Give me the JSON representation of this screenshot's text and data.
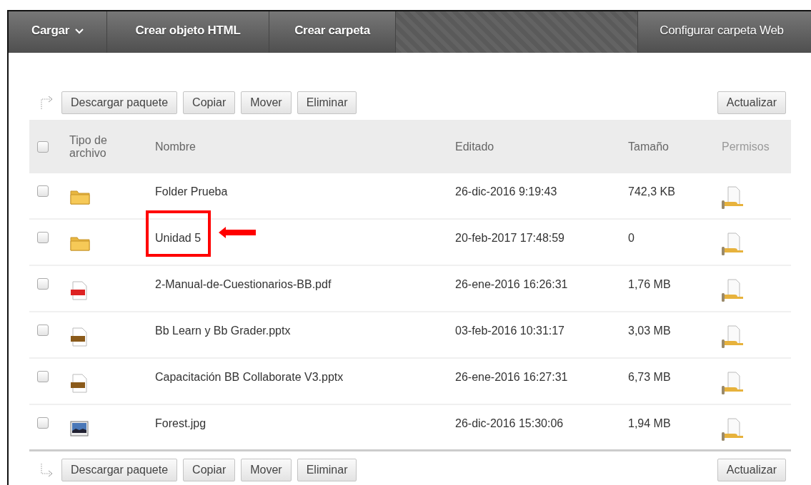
{
  "toolbar": {
    "items": [
      {
        "label": "Cargar",
        "kind": "dropdown"
      },
      {
        "label": "Crear objeto HTML",
        "kind": "button"
      },
      {
        "label": "Crear carpeta",
        "kind": "button"
      },
      {
        "label": "Configurar carpeta Web",
        "kind": "button"
      }
    ]
  },
  "top_actions": {
    "buttons": [
      "Descargar paquete",
      "Copiar",
      "Mover",
      "Eliminar"
    ],
    "refresh": "Actualizar"
  },
  "table": {
    "columns": [
      "Tipo de archivo",
      "Nombre",
      "Editado",
      "Tamaño",
      "Permisos"
    ],
    "select_all_checked": false,
    "rows": [
      {
        "kind": "folder",
        "name": "Folder Prueba",
        "edited": "26-dic-2016 9:19:43",
        "size": "742,3 KB",
        "checked": false,
        "highlighted": false
      },
      {
        "kind": "folder",
        "name": "Unidad 5",
        "edited": "20-feb-2017 17:48:59",
        "size": "0",
        "checked": false,
        "highlighted": true
      },
      {
        "kind": "pdf",
        "name": "2-Manual-de-Cuestionarios-BB.pdf",
        "edited": "26-ene-2016 16:26:31",
        "size": "1,76 MB",
        "checked": false,
        "highlighted": false
      },
      {
        "kind": "ppt",
        "name": "Bb Learn y Bb Grader.pptx",
        "edited": "03-feb-2016 10:31:17",
        "size": "3,03 MB",
        "checked": false,
        "highlighted": false
      },
      {
        "kind": "ppt",
        "name": "Capacitación BB Collaborate V3.pptx",
        "edited": "26-ene-2016 16:27:31",
        "size": "6,73 MB",
        "checked": false,
        "highlighted": false
      },
      {
        "kind": "image",
        "name": "Forest.jpg",
        "edited": "26-dic-2016 15:30:06",
        "size": "1,94 MB",
        "checked": false,
        "highlighted": false
      }
    ]
  },
  "bottom_actions": {
    "buttons": [
      "Descargar paquete",
      "Copiar",
      "Mover",
      "Eliminar"
    ],
    "refresh": "Actualizar"
  }
}
